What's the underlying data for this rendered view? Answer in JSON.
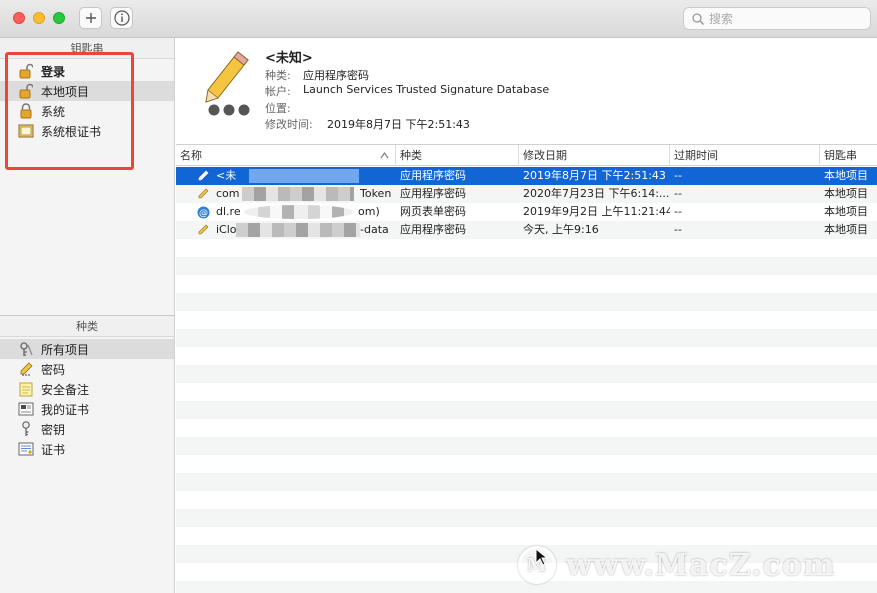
{
  "toolbar": {
    "add_icon": "plus-icon",
    "info_icon": "info-icon",
    "search_placeholder": "搜索"
  },
  "sidebar": {
    "keychains_header": "钥匙串",
    "keychains": [
      {
        "label": "登录",
        "icon": "unlocked-lock-icon"
      },
      {
        "label": "本地项目",
        "icon": "unlocked-lock-icon"
      },
      {
        "label": "系统",
        "icon": "locked-lock-icon"
      },
      {
        "label": "系统根证书",
        "icon": "cabinet-icon"
      }
    ],
    "category_header": "种类",
    "categories": [
      {
        "label": "所有项目",
        "icon": "all-items-icon"
      },
      {
        "label": "密码",
        "icon": "password-pencil-icon"
      },
      {
        "label": "安全备注",
        "icon": "secure-note-icon"
      },
      {
        "label": "我的证书",
        "icon": "my-certificate-icon"
      },
      {
        "label": "密钥",
        "icon": "key-icon"
      },
      {
        "label": "证书",
        "icon": "certificate-icon"
      }
    ]
  },
  "detail": {
    "title": "<未知>",
    "rows": [
      {
        "key": "种类:",
        "value": "应用程序密码"
      },
      {
        "key": "帐户:",
        "value": "Launch Services Trusted Signature Database"
      },
      {
        "key": "位置:",
        "value": ""
      },
      {
        "key": "修改时间:",
        "value": "2019年8月7日 下午2:51:43"
      }
    ]
  },
  "table": {
    "columns": [
      "名称",
      "种类",
      "修改日期",
      "过期时间",
      "钥匙串"
    ],
    "rows": [
      {
        "name_prefix": "<未",
        "name_suffix": "",
        "kind": "应用程序密码",
        "modified": "2019年8月7日 下午2:51:43",
        "expires": "--",
        "keychain": "本地项目"
      },
      {
        "name_prefix": "com",
        "name_suffix": "Token",
        "kind": "应用程序密码",
        "modified": "2020年7月23日 下午6:14:...",
        "expires": "--",
        "keychain": "本地项目"
      },
      {
        "name_prefix": "dl.re",
        "name_suffix": "om)",
        "kind": "网页表单密码",
        "modified": "2019年9月2日 上午11:21:44",
        "expires": "--",
        "keychain": "本地项目"
      },
      {
        "name_prefix": "iClo",
        "name_suffix": "-data",
        "kind": "应用程序密码",
        "modified": "今天, 上午9:16",
        "expires": "--",
        "keychain": "本地项目"
      }
    ]
  },
  "watermark": {
    "text": "www.MacZ.com"
  }
}
